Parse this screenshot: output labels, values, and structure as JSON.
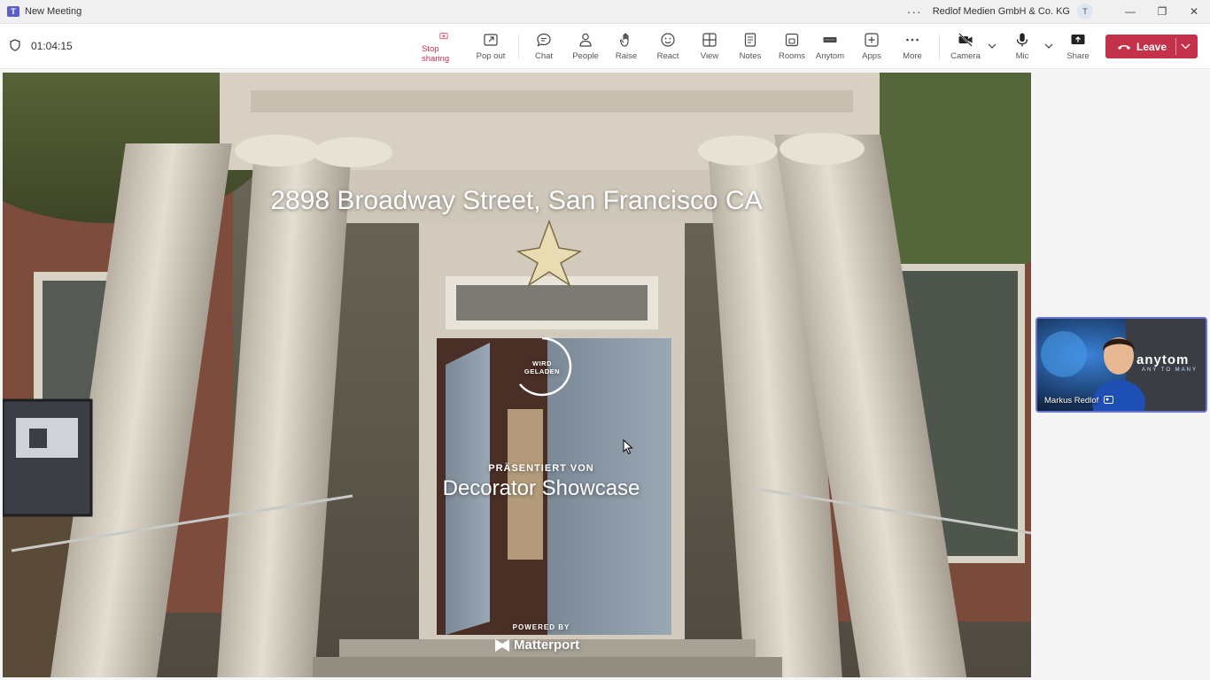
{
  "titlebar": {
    "app_title": "New Meeting",
    "org_name": "Redlof Medien GmbH & Co. KG",
    "org_initial": "T",
    "more": "···",
    "minimize": "—",
    "restore": "❐",
    "close": "✕"
  },
  "meeting": {
    "timer": "01:04:15"
  },
  "toolbar": {
    "stop_sharing": "Stop sharing",
    "pop_out": "Pop out",
    "chat": "Chat",
    "people": "People",
    "raise": "Raise",
    "react": "React",
    "view": "View",
    "notes": "Notes",
    "rooms": "Rooms",
    "anytom": "Anytom",
    "apps": "Apps",
    "more": "More",
    "camera": "Camera",
    "mic": "Mic",
    "share": "Share",
    "leave": "Leave",
    "accent_color": "#c4314b"
  },
  "shared_content": {
    "address": "2898 Broadway Street, San Francisco CA",
    "loading_label_1": "WIRD",
    "loading_label_2": "GELADEN",
    "presented_by_label": "PRÄSENTIERT VON",
    "presenter": "Decorator Showcase",
    "powered_by_label": "POWERED BY",
    "powered_by_brand": "Matterport"
  },
  "participant_tile": {
    "name": "Markus Redlof",
    "brand": "anytom",
    "slogan": "ANY TO MANY",
    "border_color": "#6b73d6"
  }
}
